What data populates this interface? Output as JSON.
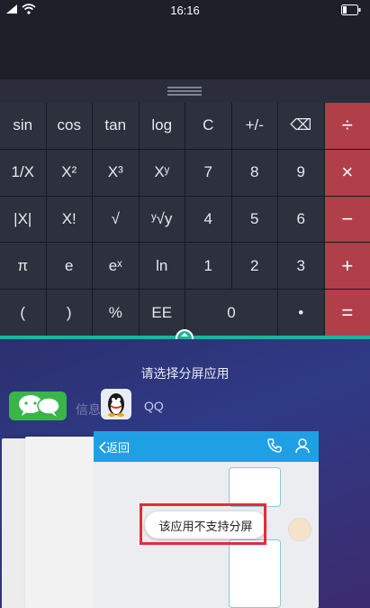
{
  "status_bar": {
    "time": "16:16"
  },
  "calculator": {
    "rows": [
      [
        "sin",
        "cos",
        "tan",
        "log",
        "C",
        "+/-",
        "⌫",
        "÷"
      ],
      [
        "1/X",
        "X²",
        "X³",
        "Xʸ",
        "7",
        "8",
        "9",
        "×"
      ],
      [
        "|X|",
        "X!",
        "√",
        "ʸ√y",
        "4",
        "5",
        "6",
        "−"
      ],
      [
        "π",
        "e",
        "eˣ",
        "ln",
        "1",
        "2",
        "3",
        "+"
      ],
      [
        "(",
        ")",
        "%",
        "EE",
        "0",
        "•",
        "="
      ]
    ]
  },
  "split_screen": {
    "title": "请选择分屏应用",
    "apps": [
      {
        "label": "信息"
      },
      {
        "label": "QQ"
      }
    ],
    "qq_window": {
      "back_label": "返回"
    },
    "toast": "该应用不支持分屏"
  },
  "colors": {
    "accent_teal": "#19b69b",
    "operator_red": "#b03f4a",
    "qq_blue": "#1fa0e4",
    "highlight_red": "#e12d3a"
  }
}
